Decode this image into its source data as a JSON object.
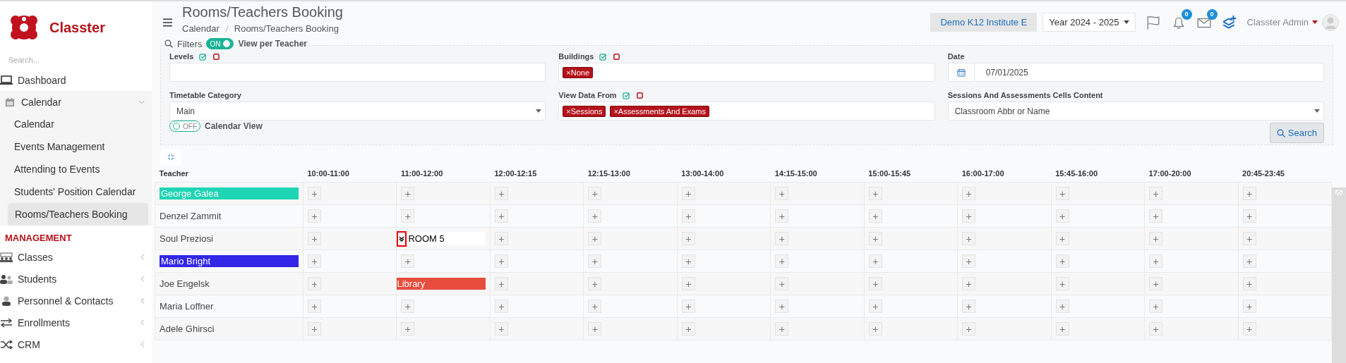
{
  "sidebar": {
    "brand": "Classter",
    "search": {
      "placeholder": "Search..."
    },
    "items": [
      {
        "label": "Dashboard",
        "expanded": false
      },
      {
        "label": "Calendar",
        "expanded": true,
        "children": [
          {
            "label": "Calendar",
            "selected": false
          },
          {
            "label": "Events Management",
            "selected": false
          },
          {
            "label": "Attending to Events",
            "selected": false
          },
          {
            "label": "Students' Position Calendar",
            "selected": false
          },
          {
            "label": "Rooms/Teachers Booking",
            "selected": true
          }
        ]
      }
    ],
    "section": "MANAGEMENT",
    "section_items": [
      {
        "label": "Classes"
      },
      {
        "label": "Students"
      },
      {
        "label": "Personnel & Contacts"
      },
      {
        "label": "Enrollments"
      },
      {
        "label": "CRM"
      }
    ]
  },
  "header": {
    "title": "Rooms/Teachers Booking",
    "breadcrumb": [
      "Calendar",
      "Rooms/Teachers Booking"
    ],
    "institute": "Demo K12 Institute E",
    "year": "Year 2024 - 2025",
    "notifications": "0",
    "messages": "0",
    "user": "Classter Admin"
  },
  "filters": {
    "label": "Filters",
    "view_toggle": {
      "label": "ON",
      "on": true,
      "caption": "View per Teacher"
    },
    "fields": [
      {
        "kind": "tags",
        "label": "Levels",
        "select_all": true
      },
      {
        "kind": "tags",
        "label": "Buildings",
        "select_all": true,
        "tags": [
          "×None"
        ]
      },
      {
        "kind": "date",
        "label": "Date",
        "value": "07/01/2025"
      },
      {
        "kind": "select",
        "label": "Timetable Category",
        "value": "Main"
      },
      {
        "kind": "tags",
        "label": "View Data From",
        "select_all": true,
        "tags": [
          "×Sessions",
          "×Assessments And Exams"
        ]
      },
      {
        "kind": "select",
        "label": "Sessions And Assessments Cells Content",
        "value": "Classroom Abbr or Name"
      }
    ],
    "calendar_toggle": {
      "label": "OFF",
      "on": false,
      "caption": "Calendar View"
    },
    "search_button": "Search"
  },
  "table": {
    "columns": [
      "Teacher",
      "10:00-11:00",
      "11:00-12:00",
      "12:00-12:15",
      "12:15-13:00",
      "13:00-14:00",
      "14:15-15:00",
      "15:00-15:45",
      "16:00-17:00",
      "15:45-16:00",
      "17:00-20:00",
      "20:45-23:45"
    ],
    "rows": [
      {
        "cells": [
          {
            "kind": "teacher",
            "label": "George Galea",
            "color": "#1ed6b3"
          },
          {
            "kind": "add",
            "label": "+"
          },
          {
            "kind": "add",
            "label": "+"
          },
          {
            "kind": "add",
            "label": "+"
          },
          {
            "kind": "add",
            "label": "+"
          },
          {
            "kind": "add",
            "label": "+"
          },
          {
            "kind": "add",
            "label": "+"
          },
          {
            "kind": "add",
            "label": "+"
          },
          {
            "kind": "add",
            "label": "+"
          },
          {
            "kind": "add",
            "label": "+"
          },
          {
            "kind": "add",
            "label": "+"
          },
          {
            "kind": "add",
            "label": "+"
          }
        ]
      },
      {
        "cells": [
          {
            "kind": "teacher",
            "label": "Denzel Zammit"
          },
          {
            "kind": "add",
            "label": "+"
          },
          {
            "kind": "add",
            "label": "+"
          },
          {
            "kind": "add",
            "label": "+"
          },
          {
            "kind": "add",
            "label": "+"
          },
          {
            "kind": "add",
            "label": "+"
          },
          {
            "kind": "add",
            "label": "+"
          },
          {
            "kind": "add",
            "label": "+"
          },
          {
            "kind": "add",
            "label": "+"
          },
          {
            "kind": "add",
            "label": "+"
          },
          {
            "kind": "add",
            "label": "+"
          },
          {
            "kind": "add",
            "label": "+"
          }
        ]
      },
      {
        "cells": [
          {
            "kind": "teacher",
            "label": "Soul Preziosi"
          },
          {
            "kind": "add",
            "label": "+"
          },
          {
            "kind": "room",
            "label": "ROOM 5",
            "highlighted": true
          },
          {
            "kind": "add",
            "label": "+"
          },
          {
            "kind": "add",
            "label": "+"
          },
          {
            "kind": "add",
            "label": "+"
          },
          {
            "kind": "add",
            "label": "+"
          },
          {
            "kind": "add",
            "label": "+"
          },
          {
            "kind": "add",
            "label": "+"
          },
          {
            "kind": "add",
            "label": "+"
          },
          {
            "kind": "add",
            "label": "+"
          },
          {
            "kind": "add",
            "label": "+"
          }
        ]
      },
      {
        "cells": [
          {
            "kind": "teacher",
            "label": "Mario Bright",
            "color": "#3326e6"
          },
          {
            "kind": "add",
            "label": "+"
          },
          {
            "kind": "add",
            "label": "+"
          },
          {
            "kind": "add",
            "label": "+"
          },
          {
            "kind": "add",
            "label": "+"
          },
          {
            "kind": "add",
            "label": "+"
          },
          {
            "kind": "add",
            "label": "+"
          },
          {
            "kind": "add",
            "label": "+"
          },
          {
            "kind": "add",
            "label": "+"
          },
          {
            "kind": "add",
            "label": "+"
          },
          {
            "kind": "add",
            "label": "+"
          },
          {
            "kind": "add",
            "label": "+"
          }
        ]
      },
      {
        "cells": [
          {
            "kind": "teacher",
            "label": "Joe Engelsk"
          },
          {
            "kind": "add",
            "label": "+"
          },
          {
            "kind": "booking",
            "label": "Library",
            "color": "#e74c3c"
          },
          {
            "kind": "add",
            "label": "+"
          },
          {
            "kind": "add",
            "label": "+"
          },
          {
            "kind": "add",
            "label": "+"
          },
          {
            "kind": "add",
            "label": "+"
          },
          {
            "kind": "add",
            "label": "+"
          },
          {
            "kind": "add",
            "label": "+"
          },
          {
            "kind": "add",
            "label": "+"
          },
          {
            "kind": "add",
            "label": "+"
          },
          {
            "kind": "add",
            "label": "+"
          }
        ]
      },
      {
        "cells": [
          {
            "kind": "teacher",
            "label": "Maria Loffner"
          },
          {
            "kind": "add",
            "label": "+"
          },
          {
            "kind": "add",
            "label": "+"
          },
          {
            "kind": "add",
            "label": "+"
          },
          {
            "kind": "add",
            "label": "+"
          },
          {
            "kind": "add",
            "label": "+"
          },
          {
            "kind": "add",
            "label": "+"
          },
          {
            "kind": "add",
            "label": "+"
          },
          {
            "kind": "add",
            "label": "+"
          },
          {
            "kind": "add",
            "label": "+"
          },
          {
            "kind": "add",
            "label": "+"
          },
          {
            "kind": "add",
            "label": "+"
          }
        ]
      },
      {
        "cells": [
          {
            "kind": "teacher",
            "label": "Adele Ghirsci"
          },
          {
            "kind": "add",
            "label": "+"
          },
          {
            "kind": "add",
            "label": "+"
          },
          {
            "kind": "add",
            "label": "+"
          },
          {
            "kind": "add",
            "label": "+"
          },
          {
            "kind": "add",
            "label": "+"
          },
          {
            "kind": "add",
            "label": "+"
          },
          {
            "kind": "add",
            "label": "+"
          },
          {
            "kind": "add",
            "label": "+"
          },
          {
            "kind": "add",
            "label": "+"
          },
          {
            "kind": "add",
            "label": "+"
          },
          {
            "kind": "add",
            "label": "+"
          }
        ]
      }
    ]
  }
}
